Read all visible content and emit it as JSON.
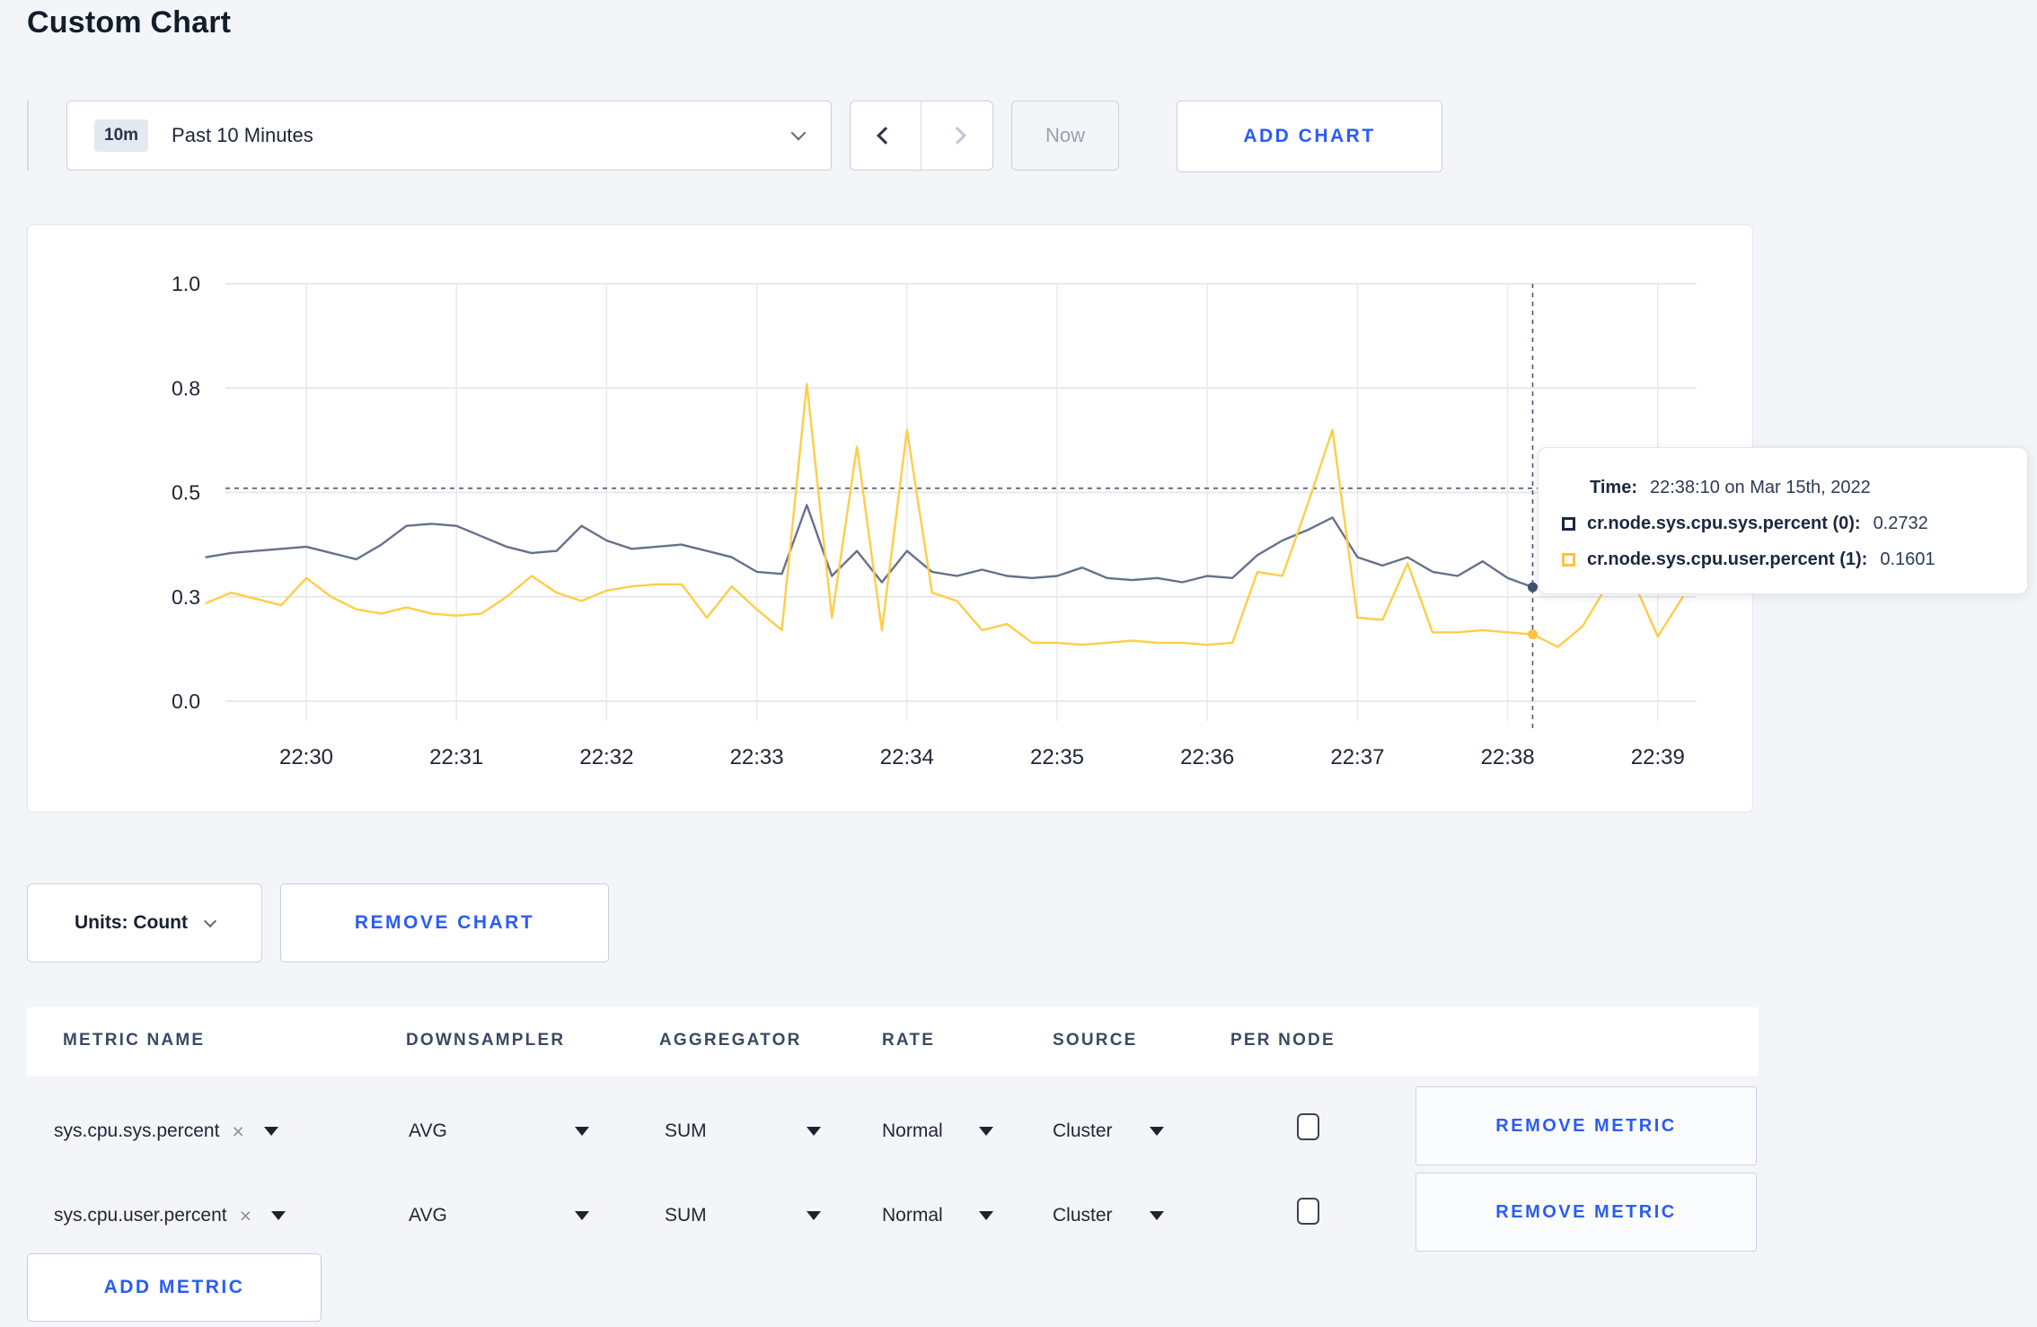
{
  "page": {
    "title": "Custom Chart"
  },
  "toolbar": {
    "range_badge": "10m",
    "range_label": "Past 10 Minutes",
    "now_label": "Now",
    "add_chart_label": "ADD CHART"
  },
  "icons": {
    "clear": "×"
  },
  "controls": {
    "units_label": "Units: Count",
    "remove_chart_label": "REMOVE CHART",
    "add_metric_label": "ADD METRIC"
  },
  "metrics_table": {
    "headers": [
      "METRIC NAME",
      "DOWNSAMPLER",
      "AGGREGATOR",
      "RATE",
      "SOURCE",
      "PER NODE"
    ],
    "remove_metric_label": "REMOVE METRIC",
    "rows": [
      {
        "metric": "sys.cpu.sys.percent",
        "downsampler": "AVG",
        "aggregator": "SUM",
        "rate": "Normal",
        "source": "Cluster",
        "per_node_checked": false
      },
      {
        "metric": "sys.cpu.user.percent",
        "downsampler": "AVG",
        "aggregator": "SUM",
        "rate": "Normal",
        "source": "Cluster",
        "per_node_checked": false
      }
    ]
  },
  "chart_data": {
    "type": "line",
    "title": "",
    "xlabel": "",
    "ylabel": "",
    "grid": true,
    "legend_position": "tooltip",
    "x_axis": {
      "labels": [
        "22:30",
        "22:31",
        "22:32",
        "22:33",
        "22:34",
        "22:35",
        "22:36",
        "22:37",
        "22:38",
        "22:39"
      ]
    },
    "y_axis": {
      "range": [
        0,
        1
      ],
      "ticks": [
        0,
        0.25,
        0.5,
        0.75,
        1.0
      ],
      "tick_labels": [
        "0.0",
        "0.3",
        "0.5",
        "0.8",
        "1.0"
      ]
    },
    "x_start_min": -0.6667,
    "x_step_min": 0.16667,
    "series": [
      {
        "name": "cr.node.sys.cpu.sys.percent (0)",
        "color": "#66718a",
        "values": [
          0.345,
          0.355,
          0.36,
          0.365,
          0.37,
          0.355,
          0.34,
          0.375,
          0.42,
          0.425,
          0.42,
          0.395,
          0.37,
          0.355,
          0.36,
          0.42,
          0.385,
          0.365,
          0.37,
          0.375,
          0.36,
          0.345,
          0.31,
          0.305,
          0.47,
          0.3,
          0.36,
          0.285,
          0.36,
          0.31,
          0.3,
          0.315,
          0.3,
          0.295,
          0.3,
          0.32,
          0.295,
          0.29,
          0.295,
          0.285,
          0.3,
          0.295,
          0.35,
          0.385,
          0.41,
          0.44,
          0.345,
          0.325,
          0.345,
          0.31,
          0.3,
          0.335,
          0.295,
          0.2732,
          0.285,
          0.29,
          0.3,
          0.31,
          0.295,
          0.3
        ]
      },
      {
        "name": "cr.node.sys.cpu.user.percent (1)",
        "color": "#ffcd47",
        "values": [
          0.235,
          0.26,
          0.245,
          0.23,
          0.295,
          0.25,
          0.22,
          0.21,
          0.225,
          0.21,
          0.205,
          0.21,
          0.25,
          0.3,
          0.26,
          0.24,
          0.265,
          0.275,
          0.28,
          0.28,
          0.2,
          0.275,
          0.22,
          0.17,
          0.76,
          0.2,
          0.61,
          0.17,
          0.65,
          0.26,
          0.24,
          0.17,
          0.185,
          0.14,
          0.14,
          0.135,
          0.14,
          0.145,
          0.14,
          0.14,
          0.135,
          0.14,
          0.31,
          0.3,
          0.47,
          0.65,
          0.2,
          0.195,
          0.33,
          0.165,
          0.165,
          0.17,
          0.165,
          0.1601,
          0.13,
          0.18,
          0.28,
          0.29,
          0.155,
          0.25
        ]
      }
    ],
    "crosshair": {
      "x_min": 8.1667,
      "y_value": 0.51,
      "color": "#4a5a75",
      "points": [
        {
          "value": 0.2732,
          "color": "#42516d"
        },
        {
          "value": 0.1601,
          "color": "#ffc43d"
        }
      ]
    },
    "tooltip": {
      "time_label": "Time:",
      "time_value": "22:38:10 on Mar 15th, 2022",
      "entries": [
        {
          "name": "cr.node.sys.cpu.sys.percent (0):",
          "value": "0.2732",
          "swatch_color": "#1c2840"
        },
        {
          "name": "cr.node.sys.cpu.user.percent (1):",
          "value": "0.1601",
          "swatch_color": "#ffc43d"
        }
      ]
    }
  }
}
